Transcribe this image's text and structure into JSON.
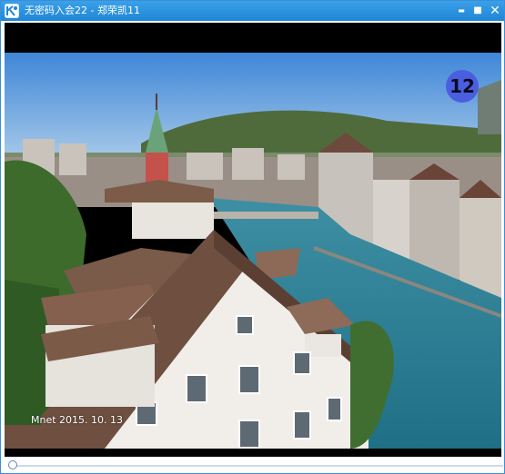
{
  "window": {
    "title": "无密码入会22 - 郑荣凯11",
    "buttons": {
      "minimize": "▬",
      "maximize": "■",
      "close": "✕"
    },
    "app_icon": "app-logo-icon",
    "accent_color": "#1f86d6"
  },
  "video": {
    "counter": "12",
    "watermark": "Mnet 2015. 10. 13",
    "badge_color": "#4a5fe0"
  },
  "playback": {
    "progress": 0.0
  }
}
